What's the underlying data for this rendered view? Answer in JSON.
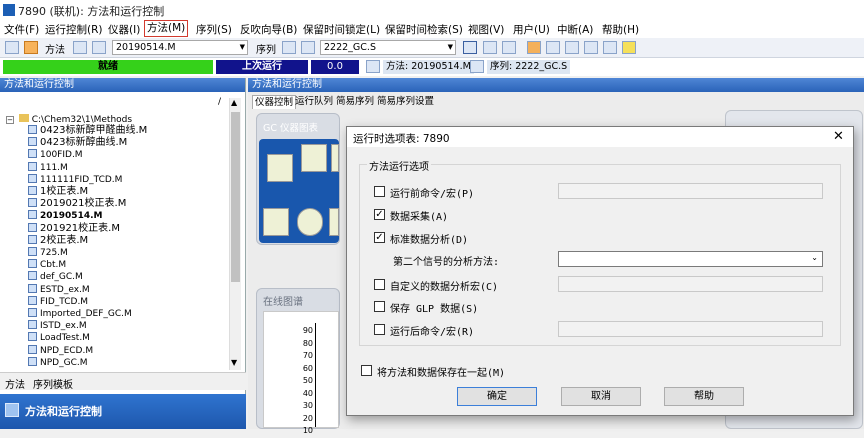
{
  "window": {
    "title": "7890 (联机): 方法和运行控制"
  },
  "menu": [
    "文件(F)",
    "运行控制(R)",
    "仪器(I)",
    "方法(M)",
    "序列(S)",
    "反吹向导(B)",
    "保留时间锁定(L)",
    "保留时间检索(S)",
    "视图(V)",
    "用户(U)",
    "中断(A)",
    "帮助(H)"
  ],
  "toolbar": {
    "method_label": "方法",
    "method_value": "20190514.M",
    "sequence_label": "序列",
    "sequence_value": "2222_GC.S"
  },
  "status": {
    "state": "就绪",
    "last_run": "上次运行",
    "value": "0.0",
    "method": "方法: 20190514.M",
    "sequence": "序列: 2222_GC.S"
  },
  "left_panel": {
    "title": "方法和运行控制",
    "path": "C:\\Chem32\\1\\Methods",
    "items": [
      {
        "label": "0423标新醇甲醛曲线.M",
        "style": "big"
      },
      {
        "label": "0423标新醇曲线.M",
        "style": "big"
      },
      {
        "label": "100FID.M",
        "style": ""
      },
      {
        "label": "111.M",
        "style": ""
      },
      {
        "label": "111111FID_TCD.M",
        "style": ""
      },
      {
        "label": "1校正表.M",
        "style": "big"
      },
      {
        "label": "2019021校正表.M",
        "style": "big"
      },
      {
        "label": "20190514.M",
        "style": "bold"
      },
      {
        "label": "201921校正表.M",
        "style": "big"
      },
      {
        "label": "2校正表.M",
        "style": "big"
      },
      {
        "label": "725.M",
        "style": ""
      },
      {
        "label": "Cbt.M",
        "style": ""
      },
      {
        "label": "def_GC.M",
        "style": ""
      },
      {
        "label": "ESTD_ex.M",
        "style": ""
      },
      {
        "label": "FID_TCD.M",
        "style": ""
      },
      {
        "label": "Imported_DEF_GC.M",
        "style": ""
      },
      {
        "label": "ISTD_ex.M",
        "style": ""
      },
      {
        "label": "LoadTest.M",
        "style": ""
      },
      {
        "label": "NPD_ECD.M",
        "style": ""
      },
      {
        "label": "NPD_GC.M",
        "style": ""
      }
    ],
    "bottom_tabs": [
      "方法",
      "序列模板"
    ],
    "footer": "方法和运行控制"
  },
  "right_panel": {
    "title": "方法和运行控制",
    "tabs": [
      "仪器控制",
      "运行队列",
      "简易序列",
      "简易序列设置"
    ],
    "gc_box_title": "GC 仪器图表",
    "online_title": "在线图谱",
    "y_ticks": [
      "90",
      "80",
      "70",
      "60",
      "50",
      "40",
      "30",
      "20",
      "10"
    ]
  },
  "dialog": {
    "title": "运行时选项表: 7890",
    "group": "方法运行选项",
    "options": [
      {
        "label": "运行前命令/宏(P)",
        "checked": false,
        "indent": false,
        "field": "text"
      },
      {
        "label": "数据采集(A)",
        "checked": true,
        "indent": false,
        "field": ""
      },
      {
        "label": "标准数据分析(D)",
        "checked": true,
        "indent": false,
        "field": ""
      },
      {
        "label": "第二个信号的分析方法:",
        "checked": null,
        "indent": true,
        "field": "select"
      },
      {
        "label": "自定义的数据分析宏(C)",
        "checked": false,
        "indent": false,
        "field": "text"
      },
      {
        "label": "保存 GLP 数据(S)",
        "checked": false,
        "indent": false,
        "field": ""
      },
      {
        "label": "运行后命令/宏(R)",
        "checked": false,
        "indent": false,
        "field": "text"
      }
    ],
    "save_together": "将方法和数据保存在一起(M)",
    "buttons": {
      "ok": "确定",
      "cancel": "取消",
      "help": "帮助"
    }
  }
}
